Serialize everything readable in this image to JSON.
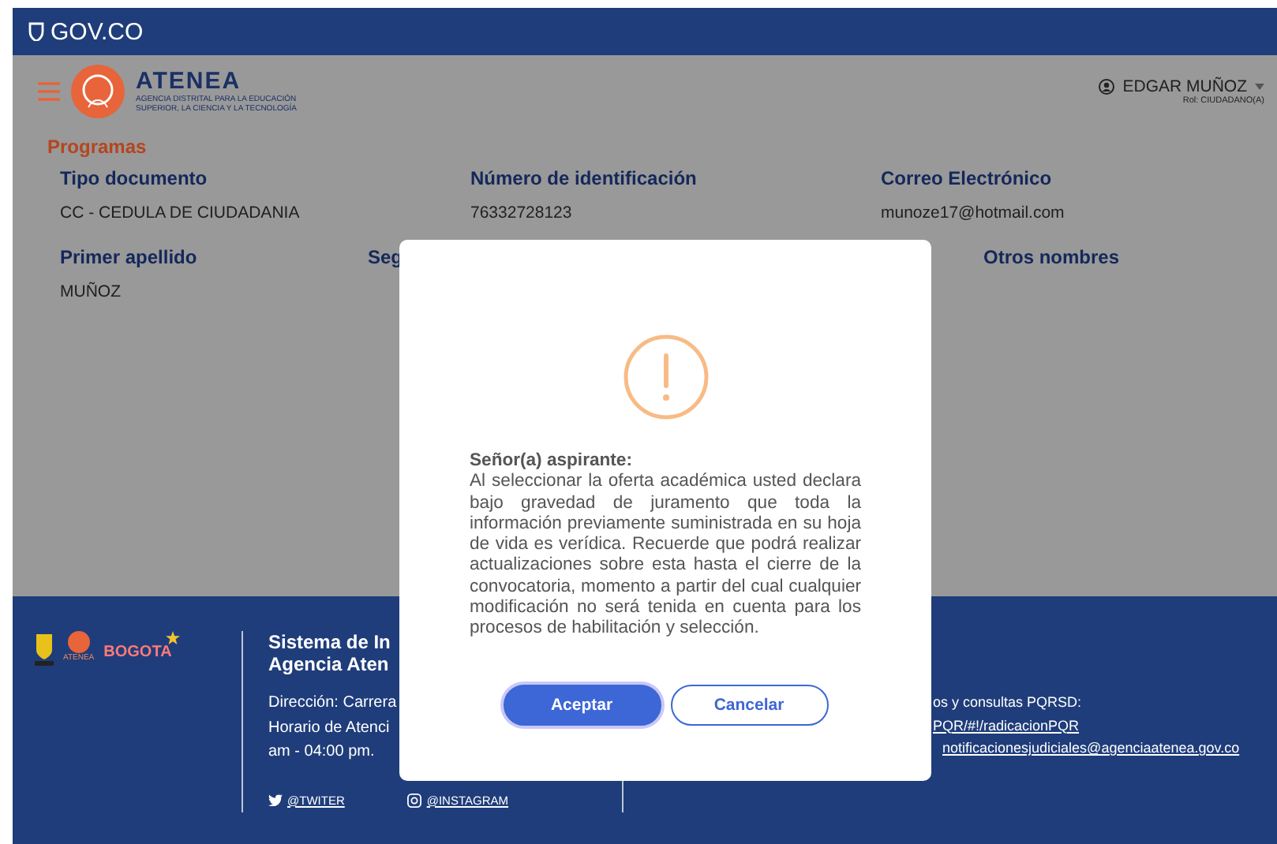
{
  "gov_bar": {
    "brand": "GOV.CO"
  },
  "header": {
    "logo_title": "ATENEA",
    "logo_subtitle": "AGENCIA DISTRITAL PARA LA EDUCACIÓN SUPERIOR, LA CIENCIA Y LA TECNOLOGÍA",
    "user_name": "EDGAR MUÑOZ",
    "user_role": "Rol: CIUDADANO(A)"
  },
  "section_title": "Programas",
  "fields_row_1": [
    {
      "label": "Tipo documento",
      "value": "CC - CEDULA DE CIUDADANIA"
    },
    {
      "label": "Número de identificación",
      "value": "76332728123"
    },
    {
      "label": "Correo Electrónico",
      "value": "munoze17@hotmail.com"
    }
  ],
  "fields_row_2": [
    {
      "label": "Primer apellido",
      "value": "MUÑOZ"
    },
    {
      "label": "Seg"
    },
    {
      "label": "Otros nombres"
    }
  ],
  "footer": {
    "logo_texts": [
      "ATENEA",
      "BOGOTA"
    ],
    "title_lines": [
      "Sistema de In",
      "Agencia Aten"
    ],
    "info_lines": [
      "Dirección: Carrera",
      "Horario de Atenci",
      "am - 04:00 pm."
    ],
    "social": [
      {
        "kind": "twitter",
        "label": "@TWITER"
      },
      {
        "kind": "instagram",
        "label": "@INSTAGRAM"
      }
    ],
    "contact_lines": [
      "os y consultas PQRSD:",
      "PQR/#!/radicacionPQR",
      "notificacionesjudiciales@agenciaatenea.gov.co"
    ]
  },
  "dialog": {
    "title": "Señor(a) aspirante:",
    "message": "Al seleccionar la oferta académica usted declara bajo gravedad de juramento que toda la información previamente suministrada en su hoja de vida es verídica. Recuerde que podrá realizar actualizaciones sobre esta hasta el cierre de la convocatoria, momento a partir del cual cualquier modificación no será tenida en cuenta para los procesos de habilitación y selección.",
    "buttons": [
      {
        "label": "Aceptar",
        "kind": "primary"
      },
      {
        "label": "Cancelar",
        "kind": "secondary"
      }
    ]
  }
}
